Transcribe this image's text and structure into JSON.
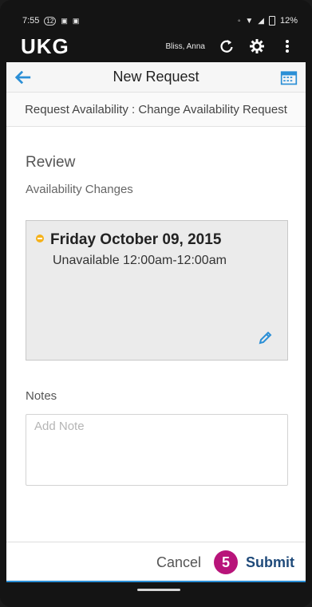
{
  "status_bar": {
    "time": "7:55",
    "left_icons": [
      "sim-12-icon",
      "notification-icon",
      "notification-icon"
    ],
    "battery": "12%"
  },
  "app_header": {
    "logo": "UKG",
    "user_name": "Bliss, Anna"
  },
  "title_bar": {
    "title": "New Request"
  },
  "request_type": "Request Availability : Change Availability Request",
  "review": {
    "heading": "Review",
    "subheading": "Availability Changes",
    "change": {
      "date": "Friday October 09, 2015",
      "detail": "Unavailable 12:00am-12:00am"
    }
  },
  "notes": {
    "label": "Notes",
    "placeholder": "Add Note",
    "value": ""
  },
  "footer": {
    "cancel_label": "Cancel",
    "step_badge": "5",
    "submit_label": "Submit"
  },
  "colors": {
    "accent_blue": "#2b8fd6",
    "badge_magenta": "#b8147a",
    "status_dot": "#f5b21b"
  }
}
